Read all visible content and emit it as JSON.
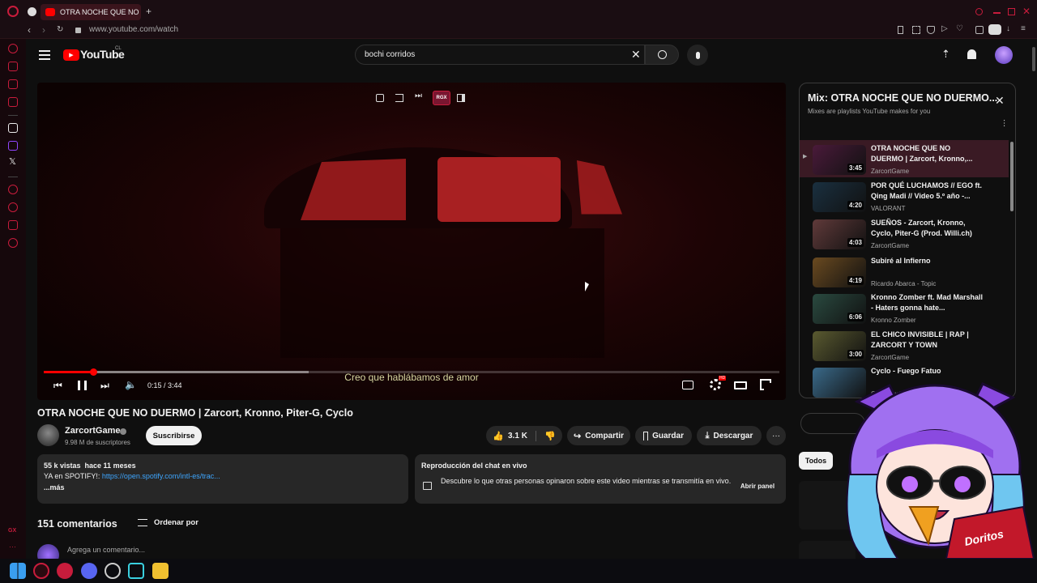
{
  "browser": {
    "tab_title": "OTRA NOCHE QUE NO DUERMO",
    "url": "www.youtube.com/watch",
    "new_tab_symbol": "+"
  },
  "youtube": {
    "logo_text": "YouTube",
    "country_code": "CL",
    "search_value": "bochi corridos"
  },
  "player": {
    "subtitle": "Creo que hablábamos de amor",
    "time": "0:15 / 3:44",
    "progress_fraction": 0.067,
    "buffer_fraction": 0.36,
    "extension_label": "RGX",
    "settings_badge": "HD"
  },
  "video": {
    "title": "OTRA NOCHE QUE NO DUERMO | Zarcort, Kronno, Piter-G, Cyclo",
    "channel": "ZarcortGame",
    "subscribers": "9.98 M de suscriptores",
    "subscribe_label": "Suscribirse",
    "likes": "3.1 K",
    "share_label": "Compartir",
    "save_label": "Guardar",
    "download_label": "Descargar"
  },
  "description": {
    "stats": "55 k vistas  hace 11 meses",
    "line_prefix": "YA en SPOTIFY!: ",
    "link": "https://open.spotify.com/intl-es/trac...",
    "more": "...más"
  },
  "chat_replay": {
    "title": "Reproducción del chat en vivo",
    "text": "Descubre lo que otras personas opinaron sobre este video mientras se transmitía en vivo.",
    "button": "Abrir panel"
  },
  "comments": {
    "count_label": "151 comentarios",
    "sort_label": "Ordenar por",
    "add_placeholder": "Agrega un comentario..."
  },
  "mix": {
    "title": "Mix: OTRA NOCHE QUE NO DUERMO...",
    "subtitle": "Mixes are playlists YouTube makes for you",
    "items": [
      {
        "title": "OTRA NOCHE QUE NO DUERMO | Zarcort, Kronno,...",
        "channel": "ZarcortGame",
        "duration": "3:45",
        "color": "#4a1a3a"
      },
      {
        "title": "POR QUÉ LUCHAMOS // EGO ft. Qing Madi // Video 5.º año -...",
        "channel": "VALORANT",
        "duration": "4:20",
        "color": "#1a3040"
      },
      {
        "title": "SUEÑOS - Zarcort, Kronno, Cyclo, Piter-G (Prod. Willi.ch)",
        "channel": "ZarcortGame",
        "duration": "4:03",
        "color": "#603a3a"
      },
      {
        "title": "Subiré al Infierno",
        "channel": "Ricardo Abarca - Topic",
        "duration": "4:19",
        "color": "#6a4a20"
      },
      {
        "title": "Kronno Zomber ft. Mad Marshall - Haters gonna hate...",
        "channel": "Kronno Zomber",
        "duration": "6:06",
        "color": "#2a4a40"
      },
      {
        "title": "EL CHICO INVISIBLE | RAP | ZARCORT Y TOWN",
        "channel": "ZarcortGame",
        "duration": "3:00",
        "color": "#5a5a30"
      },
      {
        "title": "Cyclo - Fuego Fatuo",
        "channel": "CycloMusic",
        "duration": "",
        "color": "#3a6a8a"
      }
    ]
  },
  "chips": {
    "first": "Todos"
  },
  "overlay": {
    "bag_text": "Doritos"
  },
  "colors": {
    "opera_red": "#c81c3c",
    "yt_red": "#ff0000",
    "link_blue": "#3ea6ff"
  }
}
